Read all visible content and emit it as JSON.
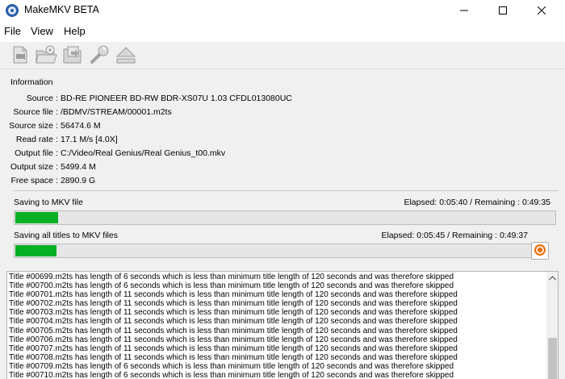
{
  "window": {
    "title": "MakeMKV BETA"
  },
  "menu": {
    "items": [
      "File",
      "View",
      "Help"
    ]
  },
  "toolbar": {
    "buttons": [
      "open-files-icon",
      "open-disc-icon",
      "backup-icon",
      "preferences-icon",
      "eject-icon"
    ]
  },
  "info": {
    "legend": "Information",
    "rows": [
      {
        "label": "Source",
        "value": "BD-RE PIONEER BD-RW  BDR-XS07U 1.03 CFDL013080UC"
      },
      {
        "label": "Source file",
        "value": "/BDMV/STREAM/00001.m2ts"
      },
      {
        "label": "Source size",
        "value": "56474.6 M"
      },
      {
        "label": "Read rate",
        "value": "17.1 M/s [4.0X]"
      },
      {
        "label": "Output file",
        "value": "C:/Video/Real Genius/Real Genius_t00.mkv"
      },
      {
        "label": "Output size",
        "value": "5499.4 M"
      },
      {
        "label": "Free space",
        "value": "2890.9 G"
      }
    ]
  },
  "progress": {
    "current": {
      "label": "Saving to MKV file",
      "elapsed": "Elapsed: 0:05:40 / Remaining : 0:49:35",
      "fraction": 0.08
    },
    "total": {
      "label": "Saving all titles to MKV files",
      "elapsed": "Elapsed: 0:05:45 / Remaining : 0:49:37",
      "fraction": 0.08
    }
  },
  "colors": {
    "progress_fill": "#06b025",
    "cancel_icon": "#e8720c"
  },
  "log": {
    "lines": [
      "Title #00699.m2ts has length of 6 seconds which is less than minimum title length of 120 seconds and was therefore skipped",
      "Title #00700.m2ts has length of 6 seconds which is less than minimum title length of 120 seconds and was therefore skipped",
      "Title #00701.m2ts has length of 11 seconds which is less than minimum title length of 120 seconds and was therefore skipped",
      "Title #00702.m2ts has length of 11 seconds which is less than minimum title length of 120 seconds and was therefore skipped",
      "Title #00703.m2ts has length of 11 seconds which is less than minimum title length of 120 seconds and was therefore skipped",
      "Title #00704.m2ts has length of 11 seconds which is less than minimum title length of 120 seconds and was therefore skipped",
      "Title #00705.m2ts has length of 11 seconds which is less than minimum title length of 120 seconds and was therefore skipped",
      "Title #00706.m2ts has length of 11 seconds which is less than minimum title length of 120 seconds and was therefore skipped",
      "Title #00707.m2ts has length of 11 seconds which is less than minimum title length of 120 seconds and was therefore skipped",
      "Title #00708.m2ts has length of 11 seconds which is less than minimum title length of 120 seconds and was therefore skipped",
      "Title #00709.m2ts has length of 6 seconds which is less than minimum title length of 120 seconds and was therefore skipped",
      "Title #00710.m2ts has length of 6 seconds which is less than minimum title length of 120 seconds and was therefore skipped"
    ]
  }
}
